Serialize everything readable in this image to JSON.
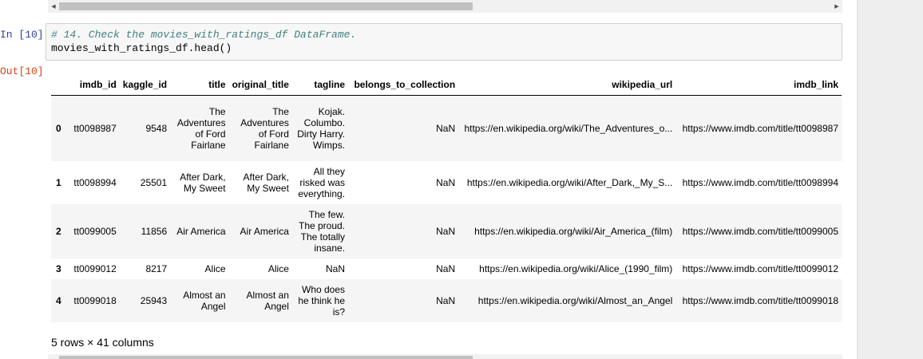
{
  "cells": {
    "in_prompt": "In [10]:",
    "out_prompt": "Out[10]:",
    "code_comment": "# 14. Check the movies_with_ratings_df DataFrame.",
    "code_line": "movies_with_ratings_df.head()"
  },
  "table": {
    "columns": [
      "",
      "imdb_id",
      "kaggle_id",
      "title",
      "original_title",
      "tagline",
      "belongs_to_collection",
      "wikipedia_url",
      "imdb_link"
    ],
    "rows": [
      [
        "0",
        "tt0098987",
        "9548",
        "The Adventures of Ford Fairlane",
        "The Adventures of Ford Fairlane",
        "Kojak. Columbo. Dirty Harry. Wimps.",
        "NaN",
        "https://en.wikipedia.org/wiki/The_Adventures_o...",
        "https://www.imdb.com/title/tt0098987"
      ],
      [
        "1",
        "tt0098994",
        "25501",
        "After Dark, My Sweet",
        "After Dark, My Sweet",
        "All they risked was everything.",
        "NaN",
        "https://en.wikipedia.org/wiki/After_Dark,_My_S...",
        "https://www.imdb.com/title/tt0098994"
      ],
      [
        "2",
        "tt0099005",
        "11856",
        "Air America",
        "Air America",
        "The few. The proud. The totally insane.",
        "NaN",
        "https://en.wikipedia.org/wiki/Air_America_(film)",
        "https://www.imdb.com/title/tt0099005"
      ],
      [
        "3",
        "tt0099012",
        "8217",
        "Alice",
        "Alice",
        "NaN",
        "NaN",
        "https://en.wikipedia.org/wiki/Alice_(1990_film)",
        "https://www.imdb.com/title/tt0099012"
      ],
      [
        "4",
        "tt0099018",
        "25943",
        "Almost an Angel",
        "Almost an Angel",
        "Who does he think he is?",
        "NaN",
        "https://en.wikipedia.org/wiki/Almost_an_Angel",
        "https://www.imdb.com/title/tt0099018"
      ]
    ]
  },
  "footer": "5 rows × 41 columns",
  "scrollbar": {
    "left_arrow": "◀",
    "right_arrow": "▶"
  }
}
